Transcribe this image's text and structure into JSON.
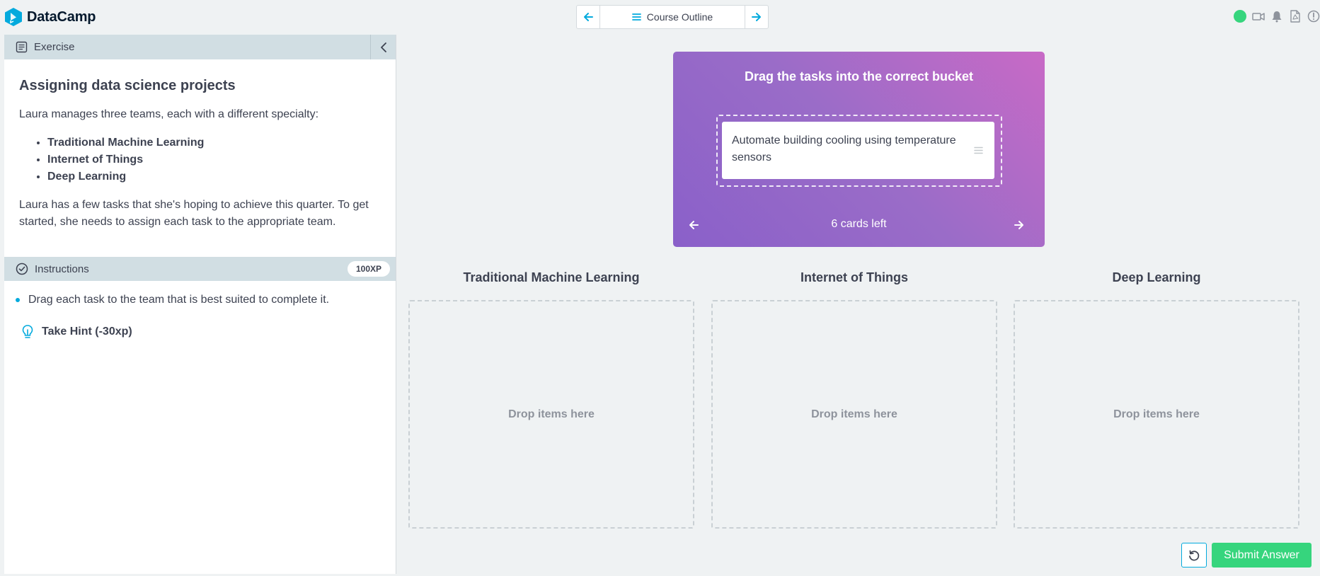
{
  "app": {
    "logo_text": "DataCamp",
    "brand_color": "#03aadd",
    "status_color": "#36d57d"
  },
  "topnav": {
    "prev_icon": "arrow-left-icon",
    "outline_label": "Course Outline",
    "next_icon": "arrow-right-icon",
    "right_icons": [
      "status-dot",
      "video-icon",
      "bell-icon",
      "pdf-icon",
      "alert-icon"
    ]
  },
  "exercise": {
    "header_label": "Exercise",
    "title": "Assigning data science projects",
    "intro": "Laura manages three teams, each with a different specialty:",
    "teams": [
      "Traditional Machine Learning",
      "Internet of Things",
      "Deep Learning"
    ],
    "body": "Laura has a few tasks that she's hoping to achieve this quarter. To get started, she needs to assign each task to the appropriate team."
  },
  "instructions": {
    "header_label": "Instructions",
    "xp": "100XP",
    "items": [
      "Drag each task to the team that is best suited to complete it."
    ],
    "hint": "Take Hint (-30xp)"
  },
  "dragdrop": {
    "prompt": "Drag the tasks into the correct bucket",
    "current_card": "Automate building cooling using temperature sensors",
    "cards_left": "6 cards left",
    "gradient_colors": [
      "#8a60c9",
      "#c86ac6"
    ],
    "buckets": [
      {
        "title": "Traditional Machine Learning",
        "placeholder": "Drop items here"
      },
      {
        "title": "Internet of Things",
        "placeholder": "Drop items here"
      },
      {
        "title": "Deep Learning",
        "placeholder": "Drop items here"
      }
    ]
  },
  "actions": {
    "reset_icon": "reset-icon",
    "submit_label": "Submit Answer"
  }
}
